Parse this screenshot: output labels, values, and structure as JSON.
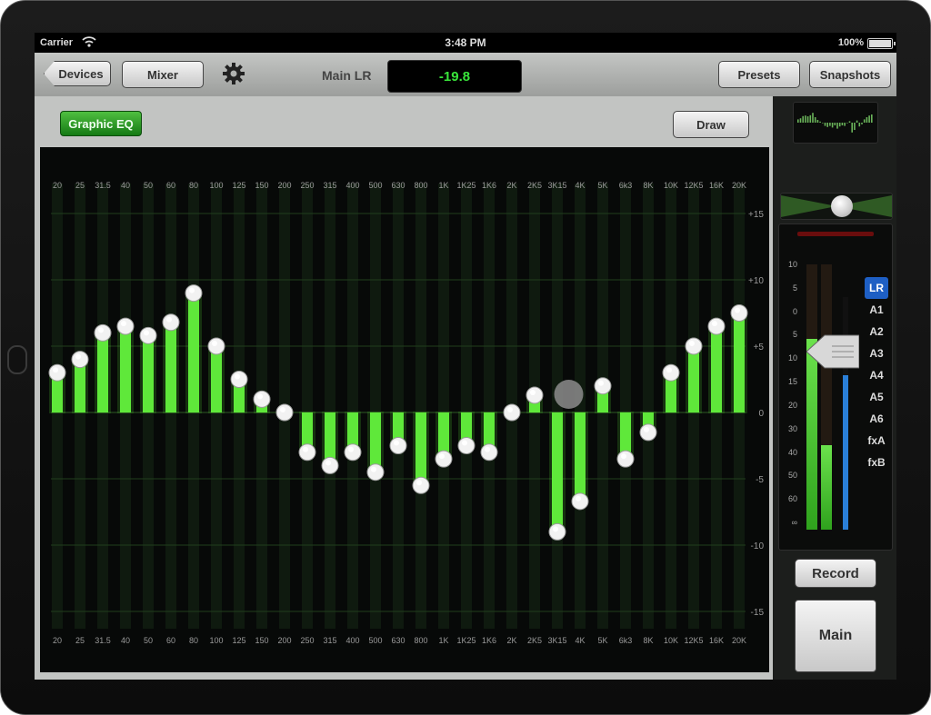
{
  "status": {
    "carrier": "Carrier",
    "time": "3:48 PM",
    "battery": "100%"
  },
  "toolbar": {
    "devices_label": "Devices",
    "mixer_label": "Mixer",
    "channel_label": "Main LR",
    "level_readout": "-19.8",
    "presets_label": "Presets",
    "snapshots_label": "Snapshots"
  },
  "eq": {
    "mode_label": "Graphic EQ",
    "draw_label": "Draw"
  },
  "chart_data": {
    "type": "bar",
    "categories": [
      "20",
      "25",
      "31.5",
      "40",
      "50",
      "60",
      "80",
      "100",
      "125",
      "150",
      "200",
      "250",
      "315",
      "400",
      "500",
      "630",
      "800",
      "1K",
      "1K25",
      "1K6",
      "2K",
      "2K5",
      "3K15",
      "4K",
      "5K",
      "6k3",
      "8K",
      "10K",
      "12K5",
      "16K",
      "20K"
    ],
    "values": [
      3,
      4,
      6,
      6.5,
      5.8,
      6.8,
      9,
      5,
      2.5,
      1,
      0,
      -3,
      -4,
      -3,
      -4.5,
      -2.5,
      -5.5,
      -3.5,
      -2.5,
      -3,
      0,
      1.3,
      -9,
      -6.7,
      2,
      -3.5,
      -1.5,
      3,
      5,
      6.5,
      7.5
    ],
    "y_ticks": [
      "+15",
      "+10",
      "+5",
      "0",
      "-5",
      "-10",
      "-15"
    ],
    "ylim": [
      -15,
      15
    ],
    "bar_color": "#5fe83a"
  },
  "sidebar": {
    "meter_scale": [
      "10",
      "5",
      "0",
      "5",
      "10",
      "15",
      "20",
      "30",
      "40",
      "50",
      "60",
      "∞"
    ],
    "meter_levels": [
      0.72,
      0.32
    ],
    "buses": [
      "LR",
      "A1",
      "A2",
      "A3",
      "A4",
      "A5",
      "A6",
      "fxA",
      "fxB"
    ],
    "record_label": "Record",
    "main_label": "Main"
  }
}
